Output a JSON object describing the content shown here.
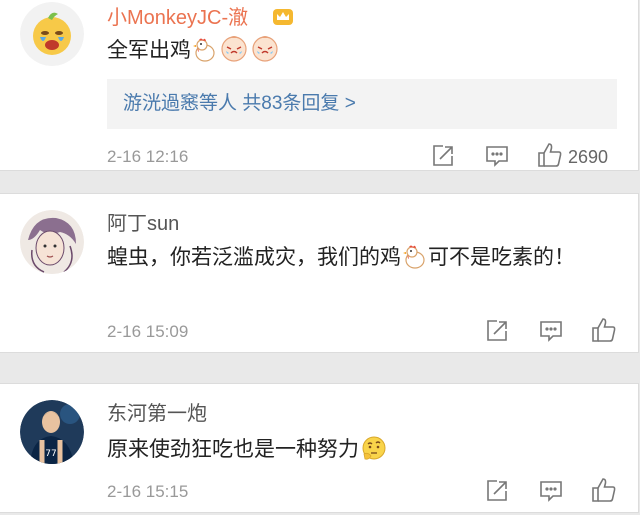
{
  "comments": [
    {
      "username": "小MonkeyJC-澈",
      "content_before": "全军出鸡",
      "content_after": "",
      "replies": {
        "names": "游洸過窸等人",
        "count": "共83条回复",
        "arrow": ">"
      },
      "timestamp": "2-16 12:16",
      "likes": "2690"
    },
    {
      "username": "阿丁sun",
      "content_before": "蝗虫，你若泛滥成灾，我们的鸡",
      "content_after": "可不是吃素的！",
      "timestamp": "2-16 15:09",
      "likes": ""
    },
    {
      "username": "东河第一炮",
      "content_before": "原来使劲狂吃也是一种努力",
      "content_after": "",
      "timestamp": "2-16 15:15",
      "likes": ""
    }
  ],
  "icons": [
    "share-icon",
    "comment-icon",
    "like-icon",
    "crown-badge-icon",
    "chicken-emoji",
    "crying-chick-emoji",
    "thinking-emoji"
  ],
  "colors": {
    "username_highlight": "#eb7350",
    "reply_link": "#4a7aad",
    "timestamp": "#999999"
  }
}
